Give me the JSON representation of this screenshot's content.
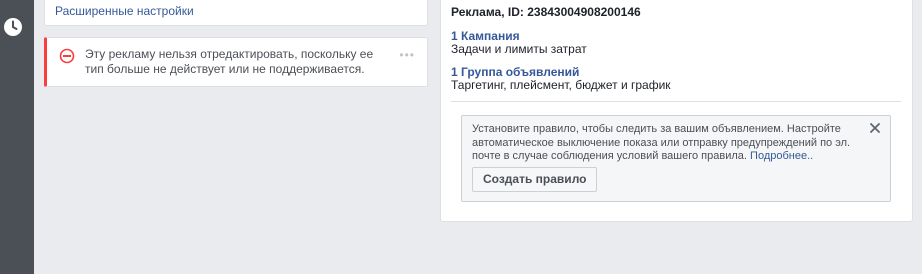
{
  "sidebar": {
    "icon": "clock-icon"
  },
  "left_panel": {
    "advanced_settings_label": "Расширенные настройки",
    "error": {
      "icon": "blocked-icon",
      "message": "Эту рекламу нельзя отредактировать, поскольку ее тип больше не действует или не поддерживается.",
      "more_label": "•••"
    }
  },
  "summary": {
    "ad_id_label": "Реклама, ID: 23843004908200146",
    "campaign_link": "1 Кампания",
    "campaign_desc": "Задачи и лимиты затрат",
    "adset_link": "1 Группа объявлений",
    "adset_desc": "Таргетинг, плейсмент, бюджет и график",
    "rule_box": {
      "text": "Установите правило, чтобы следить за вашим объявлением. Настройте автоматическое выключение показа или отправку предупреждений по эл. почте в случае соблюдения условий вашего правила.",
      "learn_more": "Подробнее..",
      "create_button": "Создать правило"
    }
  },
  "colors": {
    "link": "#365899",
    "error_accent": "#fa3e3e",
    "rail": "#4b4f56",
    "background": "#e9ebee"
  }
}
